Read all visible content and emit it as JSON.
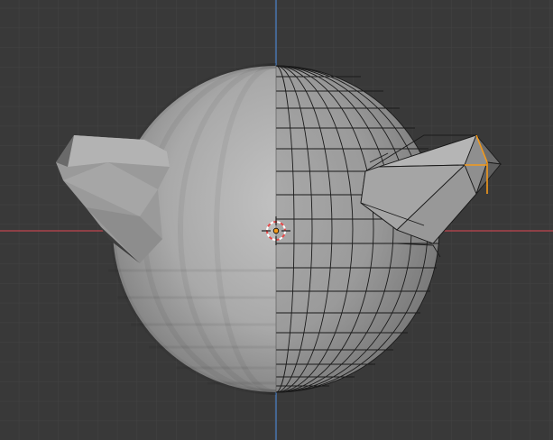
{
  "viewport": {
    "background": "#393939",
    "grid_minor_color": "#424242",
    "grid_major_color": "#4a4a4a",
    "x_axis_color": "#c0464f",
    "z_axis_color": "#4a7fc1"
  },
  "object": {
    "mirror_side_color": "#a7a7a7",
    "edit_side_color": "#9c9c9c",
    "edge_color": "#1a1a1a",
    "selected_edge_color": "#f39a1c"
  },
  "cursor": {
    "name": "3d-cursor",
    "ring_colors": [
      "#e84a4a",
      "#ffffff"
    ]
  }
}
